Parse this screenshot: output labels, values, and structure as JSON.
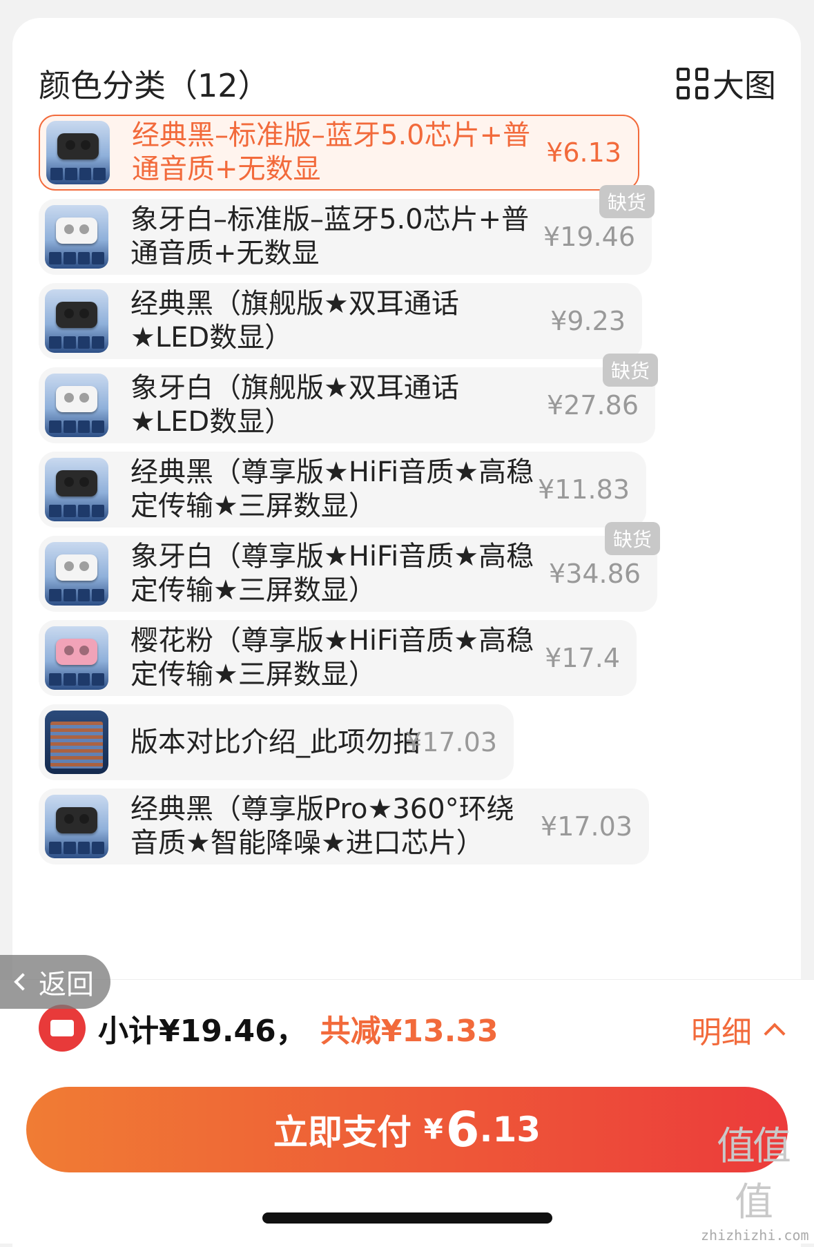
{
  "header": {
    "title": "颜色分类（12）",
    "view_toggle_label": "大图"
  },
  "options": [
    {
      "label": "经典黑–标准版–蓝牙5.0芯片+普通音质+无数显",
      "price": "¥6.13",
      "badge": ""
    },
    {
      "label": "象牙白–标准版–蓝牙5.0芯片+普通音质+无数显",
      "price": "¥19.46",
      "badge": "缺货"
    },
    {
      "label": "经典黑（旗舰版★双耳通话★LED数显）",
      "price": "¥9.23",
      "badge": ""
    },
    {
      "label": "象牙白（旗舰版★双耳通话★LED数显）",
      "price": "¥27.86",
      "badge": "缺货"
    },
    {
      "label": "经典黑（尊享版★HiFi音质★高稳定传输★三屏数显）",
      "price": "¥11.83",
      "badge": ""
    },
    {
      "label": "象牙白（尊享版★HiFi音质★高稳定传输★三屏数显）",
      "price": "¥34.86",
      "badge": "缺货"
    },
    {
      "label": "樱花粉（尊享版★HiFi音质★高稳定传输★三屏数显）",
      "price": "¥17.4",
      "badge": ""
    },
    {
      "label": "版本对比介绍_此项勿拍",
      "price": "¥17.03",
      "badge": ""
    },
    {
      "label": "经典黑（尊享版Pro★360°环绕音质★智能降噪★进口芯片）",
      "price": "¥17.03",
      "badge": ""
    }
  ],
  "back_button": {
    "label": "返回"
  },
  "footer": {
    "subtotal": "小计¥19.46，",
    "discount": "共减¥13.33",
    "detail_label": "明细",
    "pay_label": "立即支付",
    "pay_currency": "¥",
    "pay_int": "6",
    "pay_dec": ".13"
  },
  "watermark": {
    "mark": "值值值",
    "site": "zhizhizhi.com"
  },
  "colors": {
    "accent": "#f26a3b",
    "pay_start": "#f07c34",
    "pay_end": "#ec3b3b",
    "badge": "#c8c8c8"
  }
}
